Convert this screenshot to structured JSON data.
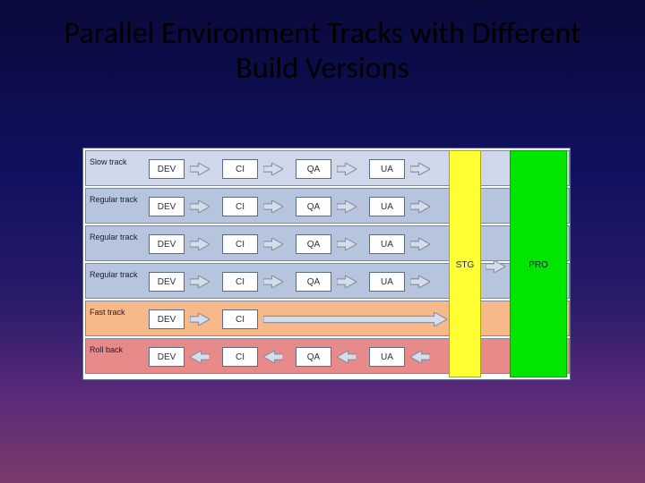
{
  "title": "Parallel Environment Tracks with Different Build Versions",
  "stages": {
    "dev": "DEV",
    "ci": "CI",
    "qa": "QA",
    "ua": "UA",
    "stg": "STG",
    "pro": "PRO"
  },
  "tracks": [
    {
      "name": "Slow track",
      "bg": "#cfd8ea",
      "stages": [
        "dev",
        "ci",
        "qa",
        "ua"
      ],
      "arrowDir": "right"
    },
    {
      "name": "Regular track",
      "bg": "#b6c4de",
      "stages": [
        "dev",
        "ci",
        "qa",
        "ua"
      ],
      "arrowDir": "right"
    },
    {
      "name": "Regular track",
      "bg": "#b6c4de",
      "stages": [
        "dev",
        "ci",
        "qa",
        "ua"
      ],
      "arrowDir": "right"
    },
    {
      "name": "Regular track",
      "bg": "#b6c4de",
      "stages": [
        "dev",
        "ci",
        "qa",
        "ua"
      ],
      "arrowDir": "right"
    },
    {
      "name": "Fast track",
      "bg": "#f7b88a",
      "stages": [
        "dev",
        "ci"
      ],
      "arrowDir": "right",
      "longArrowAfter": true
    },
    {
      "name": "Roll back",
      "bg": "#e98a8a",
      "stages": [
        "dev",
        "ci",
        "qa",
        "ua"
      ],
      "arrowDir": "left"
    }
  ],
  "layout": {
    "trackHeight": 40,
    "trackGap": 42,
    "boxW": 40,
    "boxX": [
      70,
      152,
      234,
      316
    ],
    "arrowX": [
      116,
      198,
      280,
      362
    ]
  },
  "colors": {
    "arrowFill": "#d6dde8",
    "arrowStroke": "#7a89a0"
  }
}
